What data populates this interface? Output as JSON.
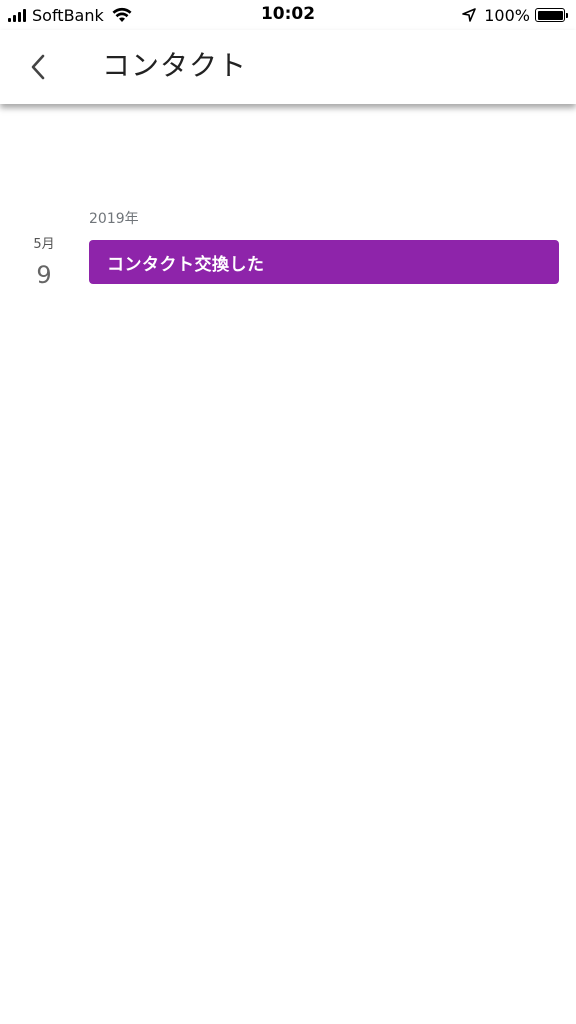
{
  "status_bar": {
    "carrier": "SoftBank",
    "time": "10:02",
    "battery_percent": "100%",
    "battery_level": 1.0,
    "icons": [
      "signal-icon",
      "wifi-icon",
      "location-arrow-icon",
      "battery-icon"
    ]
  },
  "app_bar": {
    "back_icon": "chevron-left-icon",
    "title": "コンタクト"
  },
  "timeline": {
    "year": "2019年",
    "events": [
      {
        "month": "5月",
        "day": "9",
        "title": "コンタクト交換した",
        "color": "#8e24aa"
      }
    ]
  }
}
